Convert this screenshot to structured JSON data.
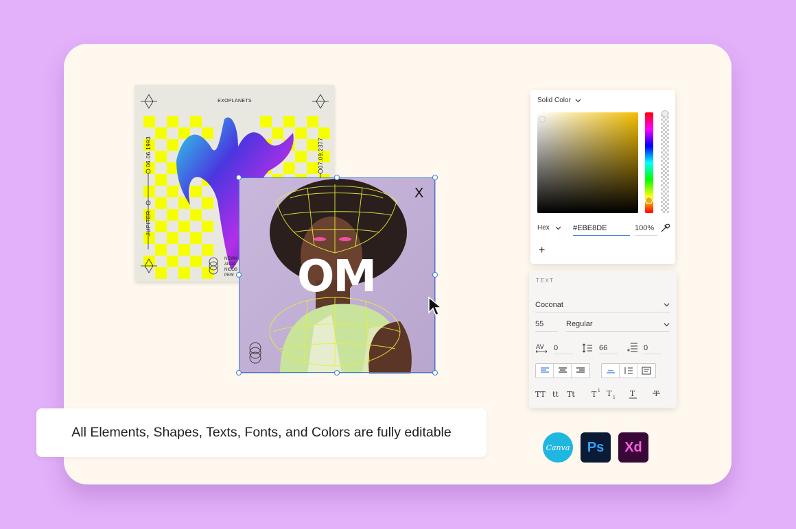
{
  "poster": {
    "title": "EXOPLANETS",
    "date_left": "06.06.1993",
    "date_right": "07.09.2377",
    "planet": "JUPITER",
    "names": [
      "NEWN",
      "ANDA",
      "NICOB",
      "PEW"
    ]
  },
  "photo": {
    "logo": "OM",
    "close_mark": "X"
  },
  "color_panel": {
    "fill_type": "Solid Color",
    "mode": "Hex",
    "hex_value": "#EBE8DE",
    "opacity": "100%",
    "add_label": "+"
  },
  "text_panel": {
    "section_label": "TEXT",
    "font_family": "Coconat",
    "font_size": "55",
    "font_weight": "Regular",
    "tracking": "0",
    "leading": "66",
    "paragraph_spacing": "0",
    "case_buttons": [
      "TT",
      "tt",
      "Tt"
    ]
  },
  "caption": "All Elements, Shapes, Texts, Fonts, and Colors are fully editable",
  "apps": {
    "canva": "Canva",
    "photoshop": "Ps",
    "xd": "Xd"
  },
  "colors": {
    "background": "#E3B0FA",
    "card": "#FFF8EE",
    "accent_yellow": "#F6FF00",
    "selection_blue": "#3D7BD8",
    "canva_blue": "#1FB6E0",
    "ps_bg": "#0B1B35",
    "ps_fg": "#2FA3FF",
    "xd_bg": "#3A0837",
    "xd_fg": "#FF5FE8"
  }
}
